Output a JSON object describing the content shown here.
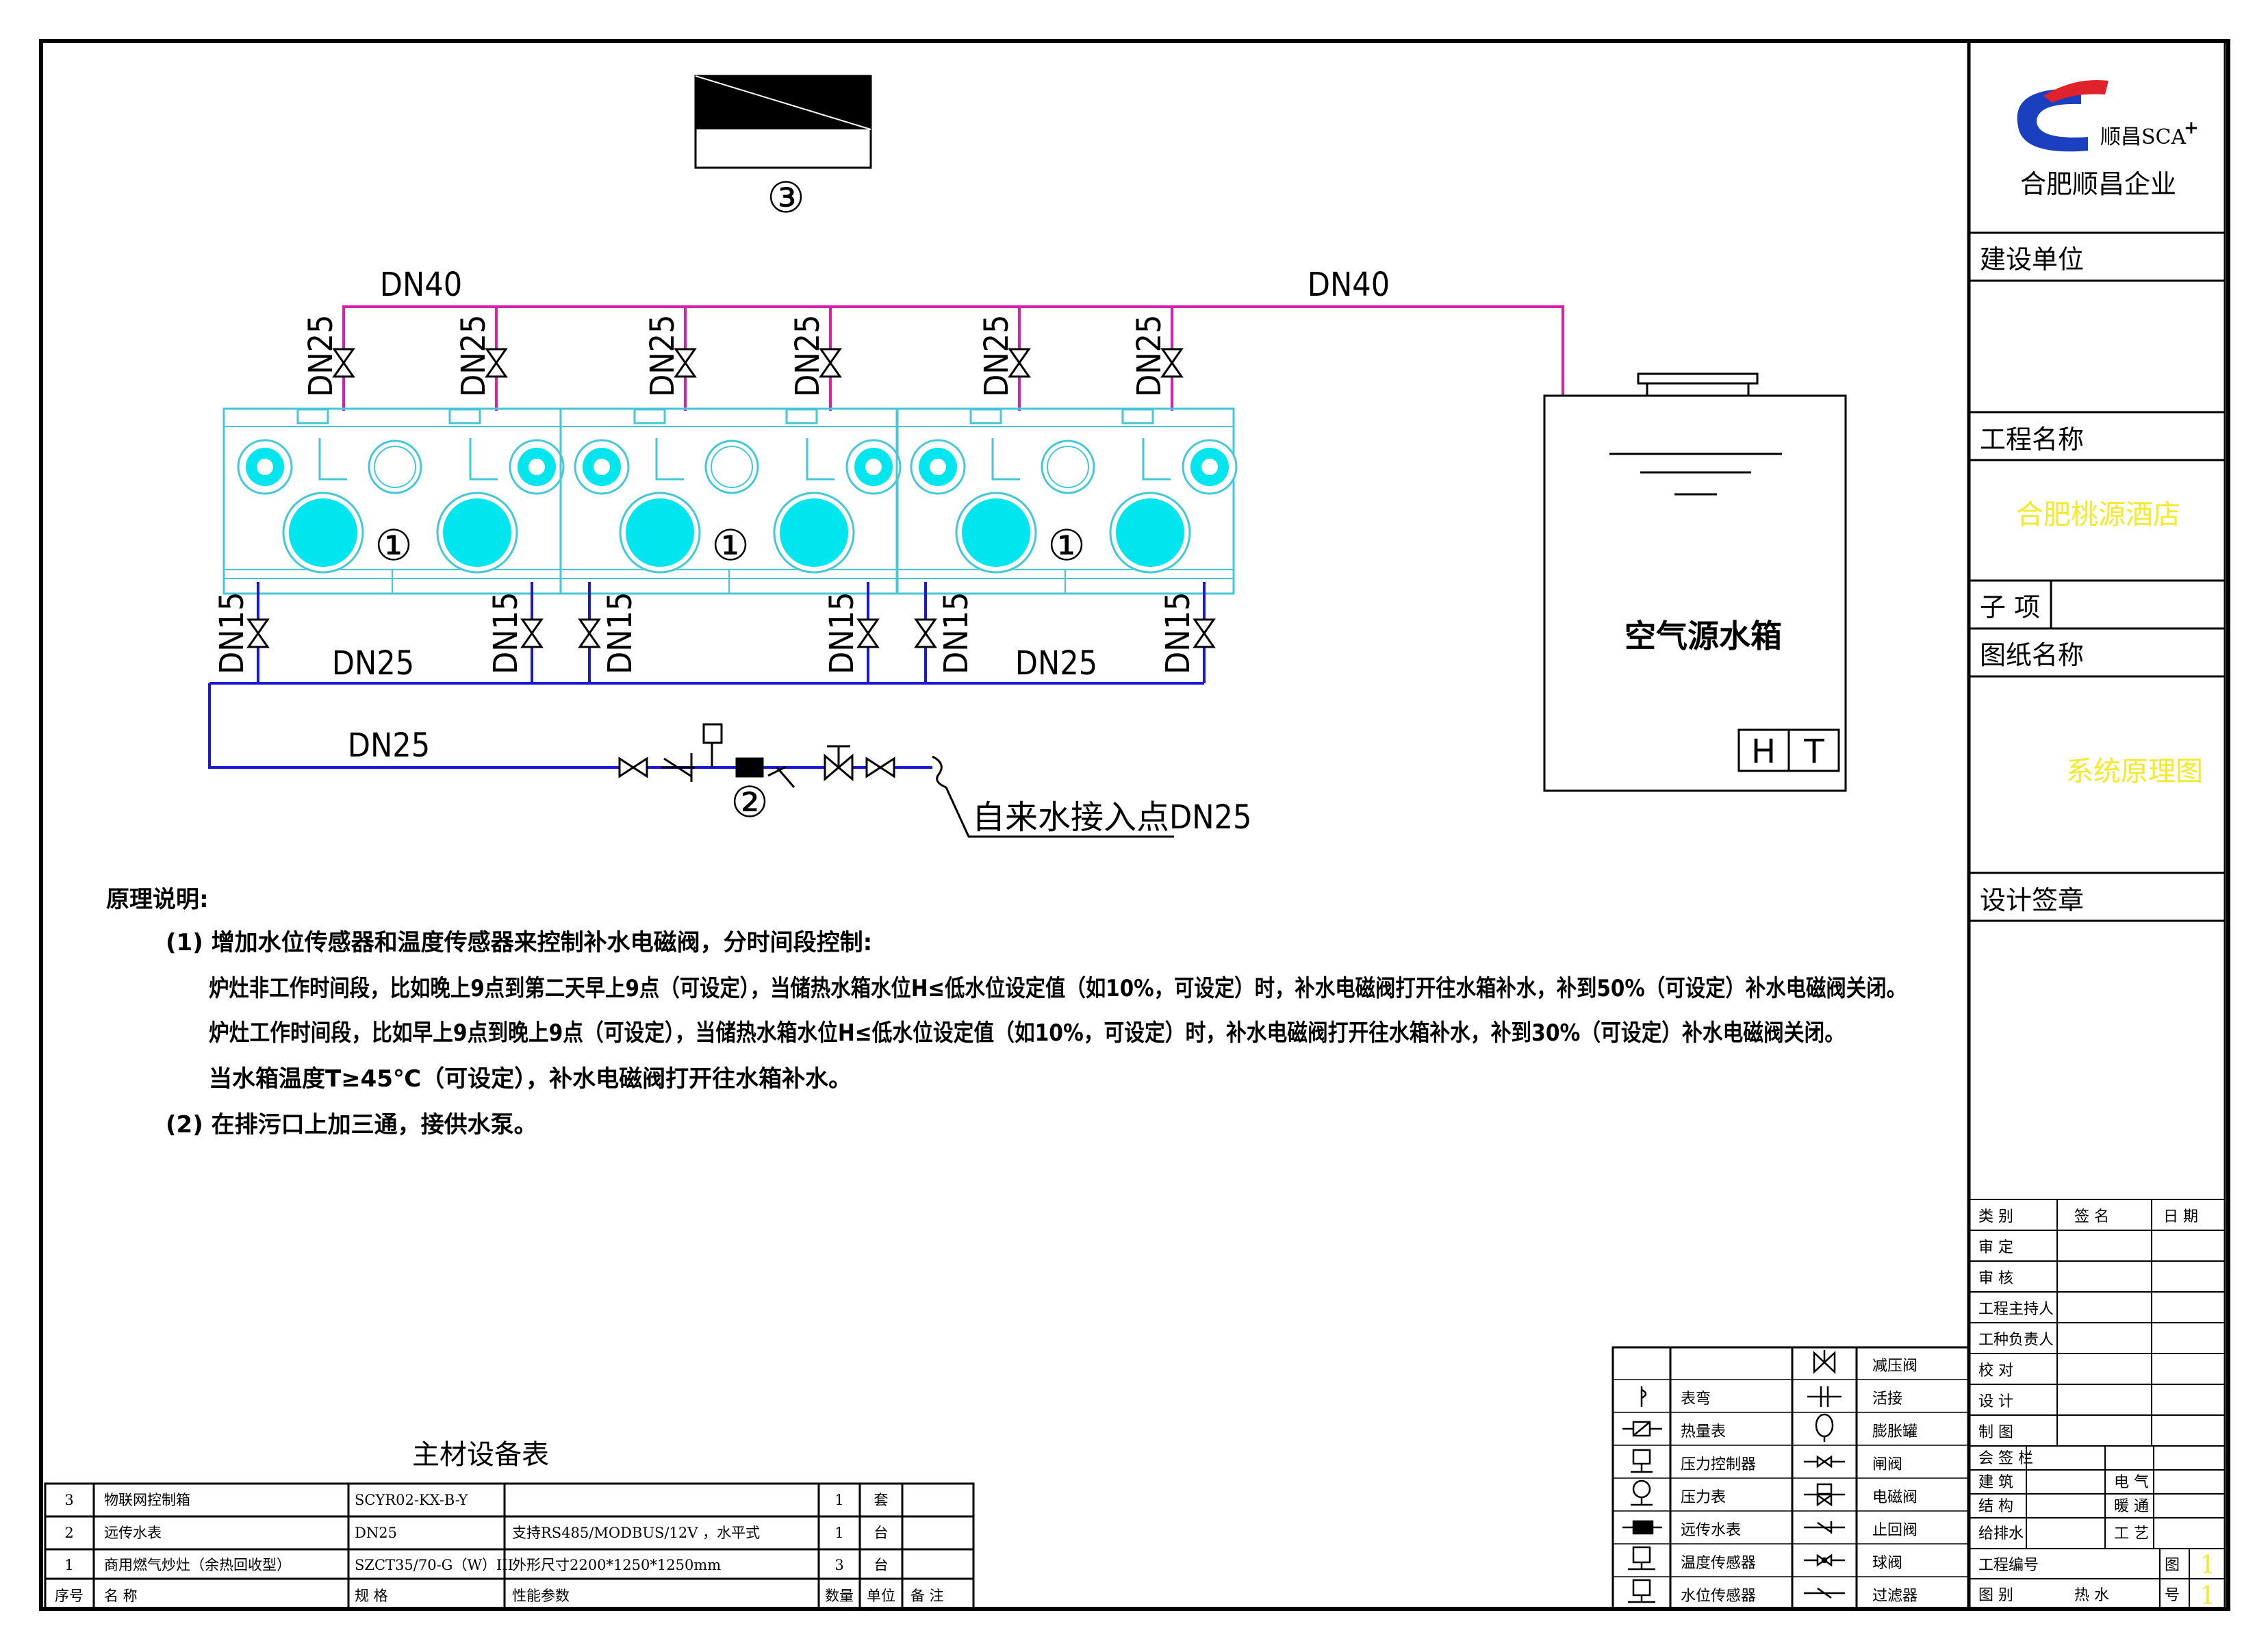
{
  "equipment_markers": {
    "hotwater": "③",
    "stove": "①",
    "meter": "②"
  },
  "pipes": {
    "main_hot_left": "DN40",
    "main_hot_right": "DN40",
    "branch_hot": "DN25",
    "branch_cold": "DN15",
    "cold_main_left": "DN25",
    "cold_main_right": "DN25",
    "supply_line": "DN25",
    "water_inlet": "自来水接入点DN25"
  },
  "tank": {
    "label": "空气源水箱",
    "sensor_h": "H",
    "sensor_t": "T"
  },
  "notes": {
    "title": "原理说明:",
    "item1": "(1) 增加水位传感器和温度传感器来控制补水电磁阀，分时间段控制:",
    "line1": "炉灶非工作时间段，比如晚上9点到第二天早上9点（可设定），当储热水箱水位H≤低水位设定值（如10%，可设定）时，补水电磁阀打开往水箱补水，补到50%（可设定）补水电磁阀关闭。",
    "line2": "炉灶工作时间段，比如早上9点到晚上9点（可设定），当储热水箱水位H≤低水位设定值（如10%，可设定）时，补水电磁阀打开往水箱补水，补到30%（可设定）补水电磁阀关闭。",
    "line3": "当水箱温度T≥45℃（可设定），补水电磁阀打开往水箱补水。",
    "item2": "(2) 在排污口上加三通，接供水泵。"
  },
  "materials": {
    "title": "主材设备表",
    "headers": [
      "序号",
      "名  称",
      "规 格",
      "性能参数",
      "数量",
      "单位",
      "备  注"
    ],
    "rows": [
      [
        "3",
        "物联网控制箱",
        "SCYR02-KX-B-Y",
        "",
        "1",
        "套",
        ""
      ],
      [
        "2",
        "远传水表",
        "DN25",
        "支持RS485/MODBUS/12V ，水平式",
        "1",
        "台",
        ""
      ],
      [
        "1",
        "商用燃气炒灶（余热回收型）",
        "SZCT35/70-G（W）III",
        "外形尺寸2200*1250*1250mm",
        "3",
        "台",
        ""
      ]
    ]
  },
  "legend": {
    "left": [
      "表弯",
      "热量表",
      "压力控制器",
      "压力表",
      "远传水表",
      "温度传感器",
      "水位传感器"
    ],
    "right": [
      "减压阀",
      "活接",
      "膨胀罐",
      "闸阀",
      "电磁阀",
      "止回阀",
      "球阀",
      "过滤器"
    ]
  },
  "title_block": {
    "company_brand": "顺昌SCA",
    "brand_plus": "+",
    "company_name": "合肥顺昌企业",
    "build_unit_label": "建设单位",
    "project_name_label": "工程名称",
    "project_name_value": "合肥桃源酒店",
    "subitem_label": "子 项",
    "drawing_name_label": "图纸名称",
    "drawing_name_value": "系统原理图",
    "design_seal_label": "设计签章",
    "sign_headers": [
      "类  别",
      "签    名",
      "日  期"
    ],
    "sign_rows": [
      "审    定",
      "审    核",
      "工程主持人",
      "工种负责人",
      "校    对",
      "设    计",
      "制    图"
    ],
    "countersign": "会 签 栏",
    "cs_rows": [
      [
        "建  筑",
        "电  气"
      ],
      [
        "结  构",
        "暖  通"
      ],
      [
        "给排水",
        "工  艺"
      ]
    ],
    "project_no": "工程编号",
    "fig_char1": "图",
    "fig_char2": "号",
    "category": "图    别",
    "category_value": "热  水",
    "num1": "1",
    "num2": "1"
  },
  "colors": {
    "hot": "#d81fb0",
    "cold": "#1a1ad6",
    "stove": "#00e5ee",
    "stove_line": "#44c8d8",
    "title_yellow": "#f2ea2a"
  }
}
